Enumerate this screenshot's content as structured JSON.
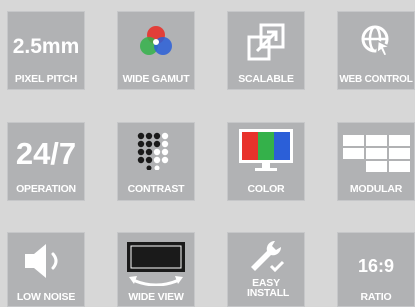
{
  "tiles": [
    {
      "id": "pixel-pitch",
      "value": "2.5mm",
      "label": "PIXEL PITCH"
    },
    {
      "id": "wide-gamut",
      "label": "WIDE GAMUT"
    },
    {
      "id": "scalable",
      "label": "SCALABLE"
    },
    {
      "id": "web-control",
      "label": "WEB CONTROL"
    },
    {
      "id": "operation",
      "value": "24/7",
      "label": "OPERATION"
    },
    {
      "id": "contrast",
      "label": "CONTRAST"
    },
    {
      "id": "color",
      "label": "COLOR"
    },
    {
      "id": "modular",
      "label": "MODULAR"
    },
    {
      "id": "low-noise",
      "label": "LOW NOISE"
    },
    {
      "id": "wide-view",
      "label": "WIDE VIEW"
    },
    {
      "id": "easy-install",
      "label": "EASY INSTALL"
    },
    {
      "id": "ratio",
      "value": "16:9",
      "label": "RATIO"
    }
  ],
  "colors": {
    "tile": "#b1b2b4",
    "background": "#d7d7d7",
    "rgb_red": "#e8322b",
    "rgb_green": "#34b14a",
    "rgb_blue": "#2b5fd8"
  }
}
